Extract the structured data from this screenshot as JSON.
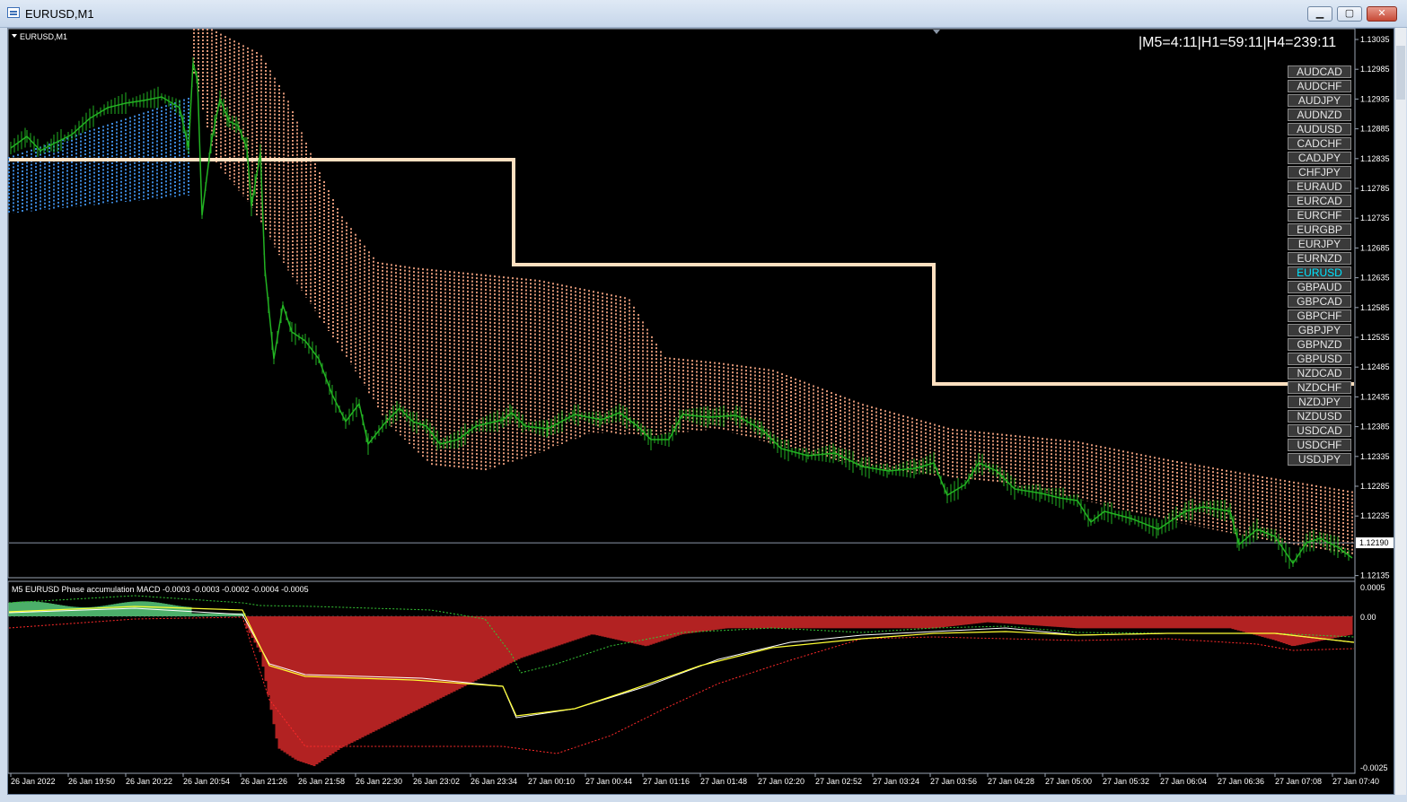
{
  "window": {
    "title": "EURUSD,M1",
    "buttons": {
      "minimize": "▁",
      "maximize": "▢",
      "close": "✕"
    }
  },
  "chart": {
    "symbol_label": "EURUSD,M1",
    "timeframe_text": "|M5=4:11|H1=59:11|H4=239:11",
    "current_price": "1.12190",
    "price_levels": [
      "1.13035",
      "1.12985",
      "1.12935",
      "1.12885",
      "1.12835",
      "1.12785",
      "1.12735",
      "1.12685",
      "1.12635",
      "1.12585",
      "1.12535",
      "1.12485",
      "1.12435",
      "1.12385",
      "1.12335",
      "1.12285",
      "1.12235",
      "1.12135"
    ],
    "time_labels": [
      "26 Jan 2022",
      "26 Jan 19:50",
      "26 Jan 20:22",
      "26 Jan 20:54",
      "26 Jan 21:26",
      "26 Jan 21:58",
      "26 Jan 22:30",
      "26 Jan 23:02",
      "26 Jan 23:34",
      "27 Jan 00:10",
      "27 Jan 00:44",
      "27 Jan 01:16",
      "27 Jan 01:48",
      "27 Jan 02:20",
      "27 Jan 02:52",
      "27 Jan 03:24",
      "27 Jan 03:56",
      "27 Jan 04:28",
      "27 Jan 05:00",
      "27 Jan 05:32",
      "27 Jan 06:04",
      "27 Jan 06:36",
      "27 Jan 07:08",
      "27 Jan 07:40"
    ],
    "symbols": [
      "AUDCAD",
      "AUDCHF",
      "AUDJPY",
      "AUDNZD",
      "AUDUSD",
      "CADCHF",
      "CADJPY",
      "CHFJPY",
      "EURAUD",
      "EURCAD",
      "EURCHF",
      "EURGBP",
      "EURJPY",
      "EURNZD",
      "EURUSD",
      "GBPAUD",
      "GBPCAD",
      "GBPCHF",
      "GBPJPY",
      "GBPNZD",
      "GBPUSD",
      "NZDCAD",
      "NZDCHF",
      "NZDJPY",
      "NZDUSD",
      "USDCAD",
      "USDCHF",
      "USDJPY"
    ],
    "active_symbol": "EURUSD",
    "colors": {
      "price": "#22b222",
      "cloud_high": "#f4a582",
      "cloud_low": "#3f8fe6",
      "level": "#ffe0c0",
      "active_symbol": "#00e5ff"
    }
  },
  "indicator": {
    "label": "M5 EURUSD Phase accumulation MACD -0.0003 -0.0003 -0.0002 -0.0004 -0.0005",
    "levels": [
      "0.0005",
      "0.00",
      "-0.0025"
    ],
    "colors": {
      "hist_pos": "#4caf6a",
      "hist_neg": "#b22222",
      "signal": "#ffff33",
      "band_up": "#35c735",
      "band_dn": "#ff2a2a",
      "line": "#ffffff"
    }
  }
}
